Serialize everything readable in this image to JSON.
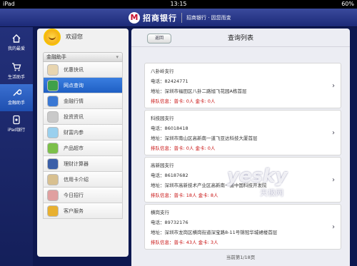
{
  "status_bar": {
    "device": "iPad",
    "time": "13:15",
    "battery": "60%"
  },
  "header": {
    "bank_name": "招商银行",
    "sub_title": "招商银行 · 因您而变",
    "logo_glyph": "M"
  },
  "nav": {
    "items": [
      {
        "label": "我的最爱",
        "icon": "home-icon"
      },
      {
        "label": "生活助手",
        "icon": "cart-icon"
      },
      {
        "label": "金融助手",
        "icon": "wrench-icon",
        "active": true
      },
      {
        "label": "iPad银行",
        "icon": "ipad-icon"
      }
    ]
  },
  "left_panel": {
    "welcome": "欢迎您",
    "section_title": "金融助手",
    "menu": [
      {
        "label": "优惠快讯",
        "color": "#e8d5b0"
      },
      {
        "label": "网点查询",
        "color": "#3fa04a",
        "active": true
      },
      {
        "label": "金融行情",
        "color": "#3a78d4"
      },
      {
        "label": "投资资讯",
        "color": "#c9c9c9"
      },
      {
        "label": "财富内参",
        "color": "#9ad0ee"
      },
      {
        "label": "产品超市",
        "color": "#7cc04a"
      },
      {
        "label": "理财计算器",
        "color": "#3b5fa8"
      },
      {
        "label": "信用卡介绍",
        "color": "#d8c090"
      },
      {
        "label": "今日招行",
        "color": "#e0a0a0"
      },
      {
        "label": "客户服务",
        "color": "#e8b030"
      }
    ]
  },
  "main": {
    "back_label": "返回",
    "title": "查询列表",
    "branches": [
      {
        "name": "八卦岭支行",
        "phone": "电话：82424771",
        "address": "地址：深圳市福田区八卦二路旭飞花园A栋首层",
        "queue": "排队信息：普卡: 0人 金卡: 0人"
      },
      {
        "name": "科技园支行",
        "phone": "电话：86018418",
        "address": "地址：深圳市南山区高新南一道飞亚达科技大厦首层",
        "queue": "排队信息：普卡: 0人 金卡: 0人"
      },
      {
        "name": "高新园支行",
        "phone": "电话：86187682",
        "address": "地址：深圳市高新技术产业区高新南一道中国科技开发院",
        "queue": "排队信息：普卡: 18人 金卡: 8人"
      },
      {
        "name": "横岗支行",
        "phone": "电话：89732176",
        "address": "地址：深圳市龙岗区横岗街道深宝路8-11号锦冠华城裙楼首层",
        "queue": "排队信息：普卡: 43人 金卡: 3人"
      }
    ],
    "pager": "当前第1/18页"
  },
  "watermark": {
    "main": "yesky",
    "sub": "天极网",
    "url": "www.yesky.com"
  },
  "colors": {
    "nav_bg": "#1c2a78",
    "active_blue": "#2a66cc",
    "queue_red": "#c81010"
  }
}
